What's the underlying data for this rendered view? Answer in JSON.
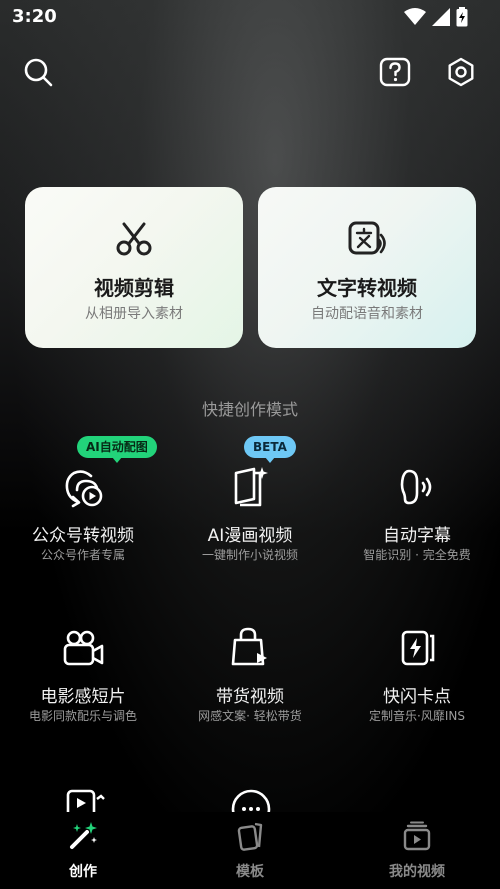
{
  "status": {
    "time": "3:20"
  },
  "topbar": {
    "icons": [
      "search-icon",
      "help-icon",
      "settings-icon"
    ]
  },
  "cards": [
    {
      "title": "视频剪辑",
      "subtitle": "从相册导入素材",
      "icon": "scissors-icon"
    },
    {
      "title": "文字转视频",
      "subtitle": "自动配语音和素材",
      "icon": "text-to-video-icon"
    }
  ],
  "section_title": "快捷创作模式",
  "modes": [
    {
      "title": "公众号转视频",
      "subtitle": "公众号作者专属",
      "badge": "AI自动配图",
      "icon": "article-convert-icon"
    },
    {
      "title": "AI漫画视频",
      "subtitle": "一键制作小说视频",
      "badge": "BETA",
      "icon": "ai-comic-icon"
    },
    {
      "title": "自动字幕",
      "subtitle": "智能识别 · 完全免费",
      "icon": "auto-caption-icon"
    },
    {
      "title": "电影感短片",
      "subtitle": "电影同款配乐与调色",
      "icon": "movie-camera-icon"
    },
    {
      "title": "带货视频",
      "subtitle": "网感文案· 轻松带货",
      "icon": "shopping-bag-icon"
    },
    {
      "title": "快闪卡点",
      "subtitle": "定制音乐·风靡INS",
      "icon": "flash-beat-icon"
    }
  ],
  "nav": [
    {
      "label": "创作",
      "icon": "magic-wand-icon",
      "active": true
    },
    {
      "label": "模板",
      "icon": "template-icon",
      "active": false
    },
    {
      "label": "我的视频",
      "icon": "my-videos-icon",
      "active": false
    }
  ],
  "colors": {
    "badge_green": "#22d37a",
    "badge_blue": "#6ec8f5",
    "background": "#000000"
  }
}
